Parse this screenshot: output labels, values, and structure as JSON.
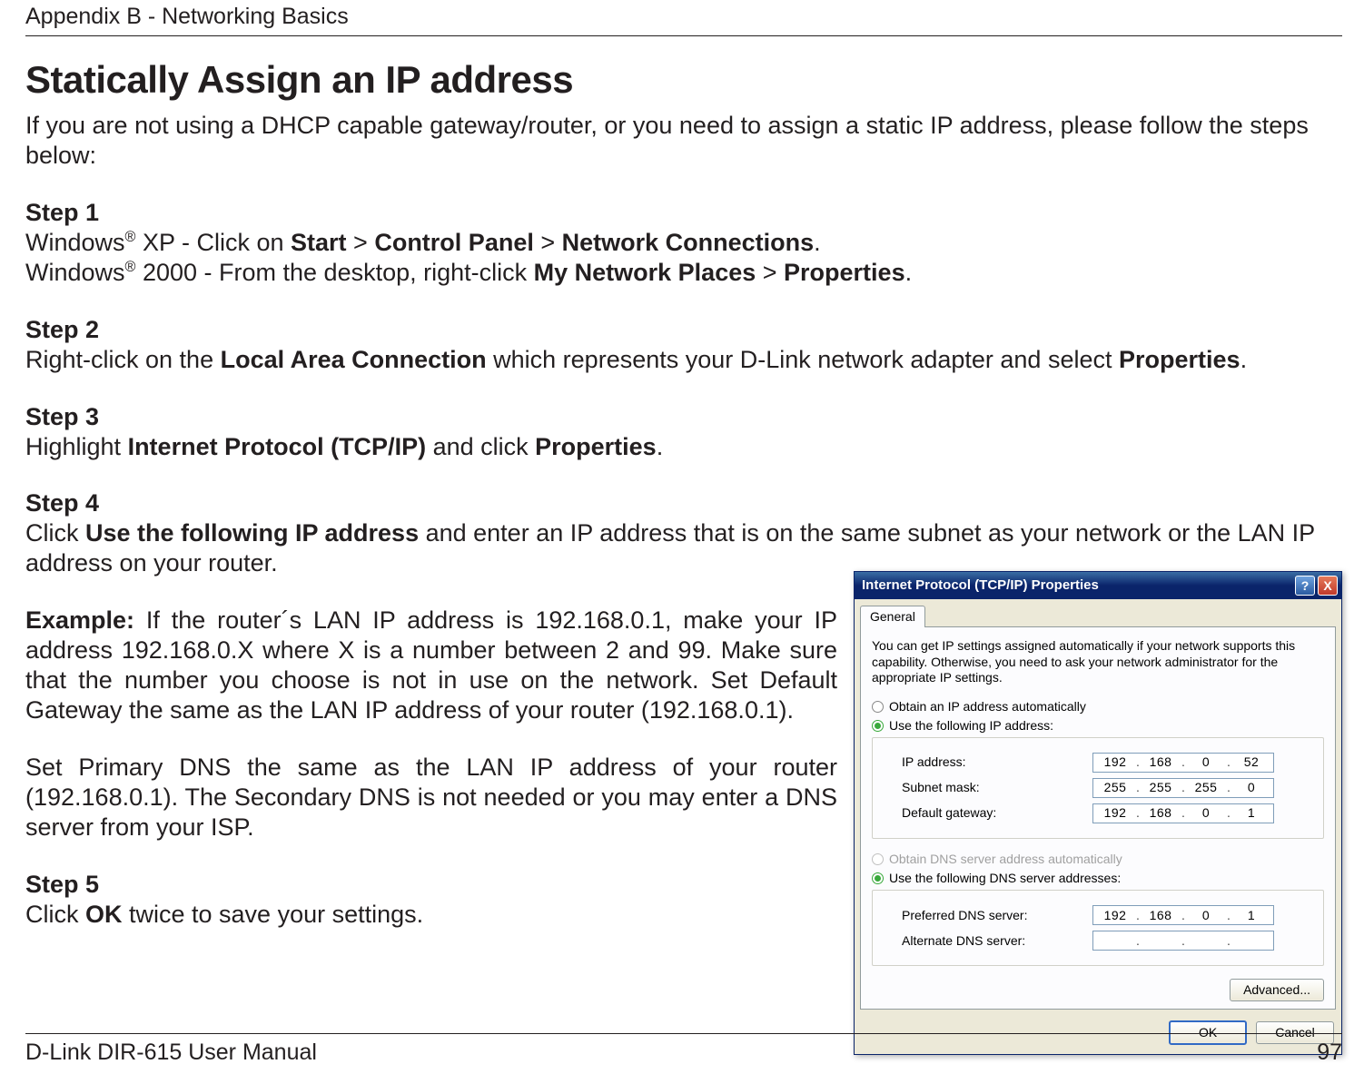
{
  "header": {
    "title": "Appendix B - Networking Basics"
  },
  "section_title": "Statically Assign an IP address",
  "intro": "If you are not using a DHCP capable gateway/router, or you need to assign a static IP address, please follow the steps below:",
  "steps": {
    "s1": {
      "hdr": "Step 1",
      "l1a": "Windows",
      "l1sup": "®",
      "l1b": " XP - Click on ",
      "start": "Start",
      "gt1": " > ",
      "cp": "Control Panel",
      "gt2": " > ",
      "nc": "Network Connections",
      "l1end": ".",
      "l2a": "Windows",
      "l2sup": "®",
      "l2b": " 2000 - From the desktop, right-click ",
      "mnp": "My Network Places",
      "gt3": " > ",
      "props": "Properties",
      "l2end": "."
    },
    "s2": {
      "hdr": "Step 2",
      "pre": "Right-click on the ",
      "lac": "Local Area Connection",
      "mid": " which represents your D-Link network adapter and select ",
      "props": "Properties",
      "end": "."
    },
    "s3": {
      "hdr": "Step 3",
      "pre": "Highlight ",
      "ipt": "Internet Protocol (TCP/IP)",
      "mid": " and click ",
      "props": "Properties",
      "end": "."
    },
    "s4": {
      "hdr": "Step 4",
      "pre": "Click ",
      "uf": "Use the following IP address",
      "rest": " and enter an IP address that is on the same subnet as your network or the LAN IP address on your router."
    },
    "example": {
      "lbl": "Example:",
      "p1": " If the router´s LAN IP address is 192.168.0.1, make your IP address 192.168.0.X where X is a number between 2 and 99. Make sure that the number you choose is not in use on the network. Set Default Gateway the same as the LAN IP address of your router (192.168.0.1).",
      "p2": "Set Primary DNS the same as the LAN IP address of your router (192.168.0.1). The Secondary DNS is not needed or you may enter a DNS server from your ISP."
    },
    "s5": {
      "hdr": "Step 5",
      "pre": "Click ",
      "ok": "OK",
      "rest": " twice to save your settings."
    }
  },
  "dialog": {
    "title": "Internet Protocol (TCP/IP) Properties",
    "help": "?",
    "close": "X",
    "tab": "General",
    "desc": "You can get IP settings assigned automatically if your network supports this capability. Otherwise, you need to ask your network administrator for the appropriate IP settings.",
    "r_auto_ip": "Obtain an IP address automatically",
    "r_use_ip": "Use the following IP address:",
    "lbl_ip": "IP address:",
    "lbl_mask": "Subnet mask:",
    "lbl_gw": "Default gateway:",
    "r_auto_dns": "Obtain DNS server address automatically",
    "r_use_dns": "Use the following DNS server addresses:",
    "lbl_pdns": "Preferred DNS server:",
    "lbl_adns": "Alternate DNS server:",
    "ip": {
      "a": "192",
      "b": "168",
      "c": "0",
      "d": "52"
    },
    "mask": {
      "a": "255",
      "b": "255",
      "c": "255",
      "d": "0"
    },
    "gw": {
      "a": "192",
      "b": "168",
      "c": "0",
      "d": "1"
    },
    "pdns": {
      "a": "192",
      "b": "168",
      "c": "0",
      "d": "1"
    },
    "adns": {
      "a": "",
      "b": "",
      "c": "",
      "d": ""
    },
    "advanced": "Advanced...",
    "ok": "OK",
    "cancel": "Cancel"
  },
  "footer": {
    "left": "D-Link DIR-615 User Manual",
    "right": "97"
  }
}
